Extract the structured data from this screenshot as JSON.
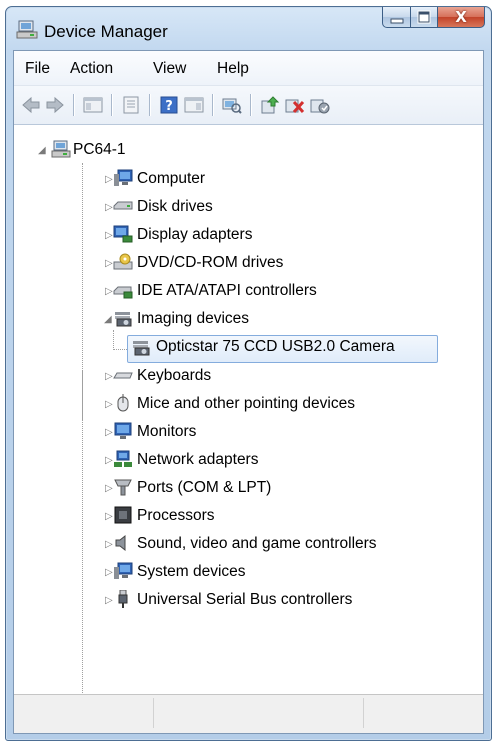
{
  "window": {
    "title": "Device Manager"
  },
  "caption_buttons": {
    "close_glyph": "X"
  },
  "menu": [
    "File",
    "Action",
    "View",
    "Help"
  ],
  "toolbar": {
    "icons": [
      "back-icon",
      "forward-icon",
      "show-hide-console-tree-icon",
      "properties-icon",
      "help-icon",
      "action-pane-icon",
      "scan-hardware-icon",
      "update-driver-icon",
      "uninstall-icon",
      "disable-icon"
    ]
  },
  "tree": {
    "root": "PC64-1",
    "items": [
      {
        "label": "Computer",
        "icon": "computer-icon",
        "expanded": false
      },
      {
        "label": "Disk drives",
        "icon": "disk-drive-icon",
        "expanded": false
      },
      {
        "label": "Display adapters",
        "icon": "display-adapter-icon",
        "expanded": false
      },
      {
        "label": "DVD/CD-ROM drives",
        "icon": "dvd-drive-icon",
        "expanded": false
      },
      {
        "label": "IDE ATA/ATAPI controllers",
        "icon": "ide-controller-icon",
        "expanded": false
      },
      {
        "label": "Imaging devices",
        "icon": "imaging-device-icon",
        "expanded": true,
        "children": [
          {
            "label": "Opticstar 75 CCD USB2.0 Camera",
            "icon": "camera-icon",
            "selected": true
          }
        ]
      },
      {
        "label": "Keyboards",
        "icon": "keyboard-icon",
        "expanded": false
      },
      {
        "label": "Mice and other pointing devices",
        "icon": "mouse-icon",
        "expanded": false
      },
      {
        "label": "Monitors",
        "icon": "monitor-icon",
        "expanded": false
      },
      {
        "label": "Network adapters",
        "icon": "network-adapter-icon",
        "expanded": false
      },
      {
        "label": "Ports (COM & LPT)",
        "icon": "port-icon",
        "expanded": false
      },
      {
        "label": "Processors",
        "icon": "processor-icon",
        "expanded": false
      },
      {
        "label": "Sound, video and game controllers",
        "icon": "sound-icon",
        "expanded": false
      },
      {
        "label": "System devices",
        "icon": "system-device-icon",
        "expanded": false
      },
      {
        "label": "Universal Serial Bus controllers",
        "icon": "usb-icon",
        "expanded": false
      }
    ]
  },
  "colors": {
    "selection_border": "#84acdd",
    "titlebar": "#c2d8ef",
    "close_button": "#c2432a"
  }
}
